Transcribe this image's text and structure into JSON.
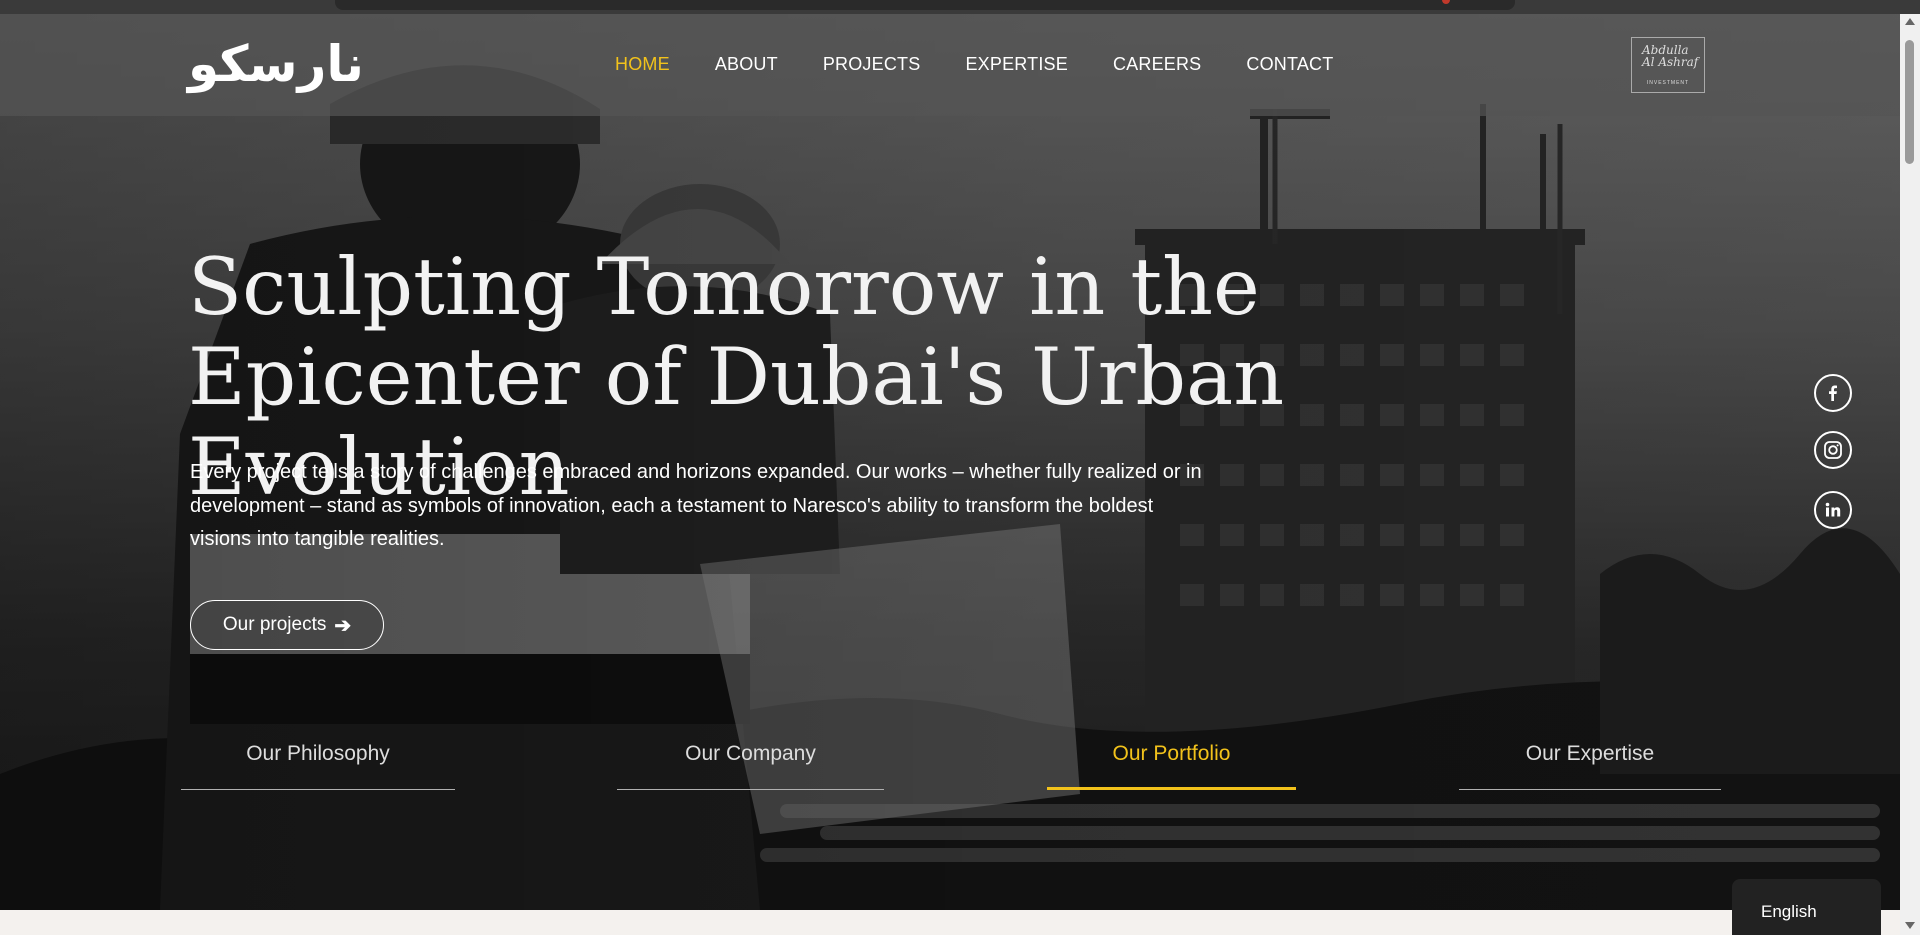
{
  "header": {
    "logo_text": "نارسكو",
    "nav": [
      {
        "label": "HOME",
        "active": true
      },
      {
        "label": "ABOUT",
        "active": false
      },
      {
        "label": "PROJECTS",
        "active": false
      },
      {
        "label": "EXPERTISE",
        "active": false
      },
      {
        "label": "CAREERS",
        "active": false
      },
      {
        "label": "CONTACT",
        "active": false
      }
    ],
    "partner_badge": {
      "signature": "Abdulla Al Ashraf",
      "caption": "INVESTMENT"
    }
  },
  "hero": {
    "headline_line1": "Sculpting Tomorrow in the",
    "headline_line2": "Epicenter of Dubai's Urban Evolution",
    "lede": "Every project tells a story of challenges embraced and horizons expanded. Our works  – whether fully realized or in development – stand as symbols of innovation, each a testament to Naresco's ability to transform the boldest visions into tangible realities.",
    "cta_label": "Our projects",
    "cta_icon": "arrow-right-icon"
  },
  "tabs": [
    {
      "label": "Our Philosophy",
      "active": false
    },
    {
      "label": "Our Company",
      "active": false
    },
    {
      "label": "Our Portfolio",
      "active": true
    },
    {
      "label": "Our Expertise",
      "active": false
    }
  ],
  "social": [
    {
      "name": "facebook-icon"
    },
    {
      "name": "instagram-icon"
    },
    {
      "name": "linkedin-icon"
    }
  ],
  "language": {
    "selected": "English"
  },
  "colors": {
    "accent": "#f2c21b",
    "text": "#ffffff",
    "header_bg": "#555555"
  }
}
